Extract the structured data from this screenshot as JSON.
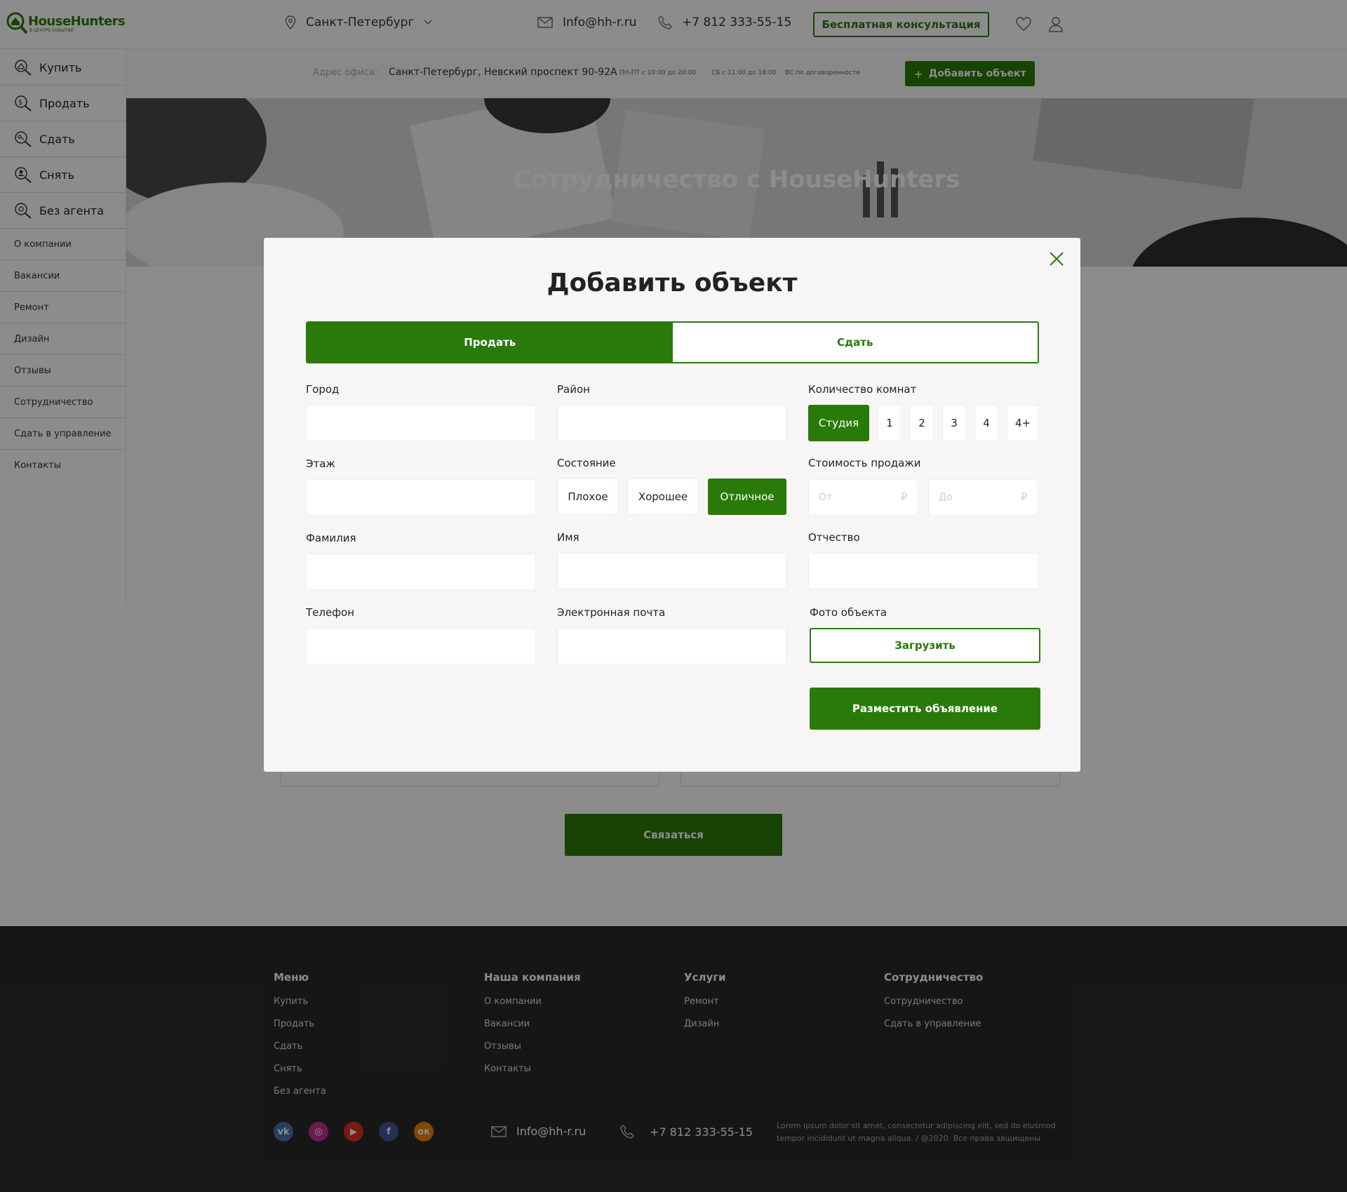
{
  "header": {
    "logo_text": "HouseHunters",
    "logo_subtext": "В ЦЕНТРЕ СОБЫТИЙ",
    "city": "Санкт-Петербург",
    "email": "Info@hh-r.ru",
    "phone": "+7 812 333-55-15",
    "consult_button": "Бесплатная консультация"
  },
  "subheader": {
    "office_label": "Адрес офиса:",
    "office_address": "Санкт-Петербург, Невский проспект 90-92А",
    "hours_weekdays": "ПН-ПТ с 10:00 до 20:00",
    "hours_saturday": "СБ с 11:00 до 18:00",
    "hours_sunday": "ВС по договоренности",
    "add_button": "Добавить объект"
  },
  "sidebar": {
    "main_items": [
      {
        "label": "Купить",
        "icon": "search-house-icon"
      },
      {
        "label": "Продать",
        "icon": "search-money-icon"
      },
      {
        "label": "Сдать",
        "icon": "search-key-icon"
      },
      {
        "label": "Снять",
        "icon": "search-people-icon"
      },
      {
        "label": "Без агента",
        "icon": "search-no-agent-icon"
      }
    ],
    "sub_items": [
      "О компании",
      "Вакансии",
      "Ремонт",
      "Дизайн",
      "Отзывы",
      "Сотрудничество",
      "Сдать в управление",
      "Контакты"
    ]
  },
  "hero": {
    "title": "Сотрудничество с HouseHunters"
  },
  "page": {
    "contact_button": "Связаться"
  },
  "modal": {
    "title": "Добавить объект",
    "tabs": [
      "Продать",
      "Сдать"
    ],
    "active_tab": "Продать",
    "fields": {
      "city": "Город",
      "district": "Район",
      "rooms": "Количество комнат",
      "floor": "Этаж",
      "condition": "Состояние",
      "price": "Стоимость продажи",
      "last_name": "Фамилия",
      "first_name": "Имя",
      "patronymic": "Отчество",
      "phone": "Телефон",
      "email": "Электронная почта",
      "photo": "Фото объекта"
    },
    "room_options": [
      "Студия",
      "1",
      "2",
      "3",
      "4",
      "4+"
    ],
    "selected_room": "Студия",
    "condition_options": [
      "Плохое",
      "Хорошее",
      "Отличное"
    ],
    "selected_condition": "Отличное",
    "price_from_placeholder": "От",
    "price_to_placeholder": "До",
    "currency": "₽",
    "upload_button": "Загрузить",
    "submit_button": "Разместить объявление"
  },
  "footer": {
    "columns": [
      {
        "title": "Меню",
        "items": [
          "Купить",
          "Продать",
          "Сдать",
          "Снять",
          "Без агента"
        ]
      },
      {
        "title": "Наша компания",
        "items": [
          "О компании",
          "Вакансии",
          "Отзывы",
          "Контакты"
        ]
      },
      {
        "title": "Услуги",
        "items": [
          "Ремонт",
          "Дизайн"
        ]
      },
      {
        "title": "Сотрудничество",
        "items": [
          "Сотрудничество",
          "Сдать в управление"
        ]
      }
    ],
    "social": [
      {
        "name": "vk-icon",
        "glyph": "vk",
        "color": "#4a76a8"
      },
      {
        "name": "instagram-icon",
        "glyph": "◎",
        "color": "#c1358a"
      },
      {
        "name": "youtube-icon",
        "glyph": "▶",
        "color": "#e52d27"
      },
      {
        "name": "facebook-icon",
        "glyph": "f",
        "color": "#3b5998"
      },
      {
        "name": "odnoklassniki-icon",
        "glyph": "ок",
        "color": "#ee8208"
      }
    ],
    "email": "Info@hh-r.ru",
    "phone": "+7 812 333-55-15",
    "copy_line1": "Lorem ipsum dolor sit amet, consectetur adipiscing elit, sed do eiusmod",
    "copy_line2": "tempor incididunt ut  magna aliqua.  / @2020. Все права защищены"
  },
  "colors": {
    "brand_green": "#2a7a0a",
    "footer_bg": "#2b292a",
    "overlay": "rgba(0,0,0,0.45)"
  }
}
